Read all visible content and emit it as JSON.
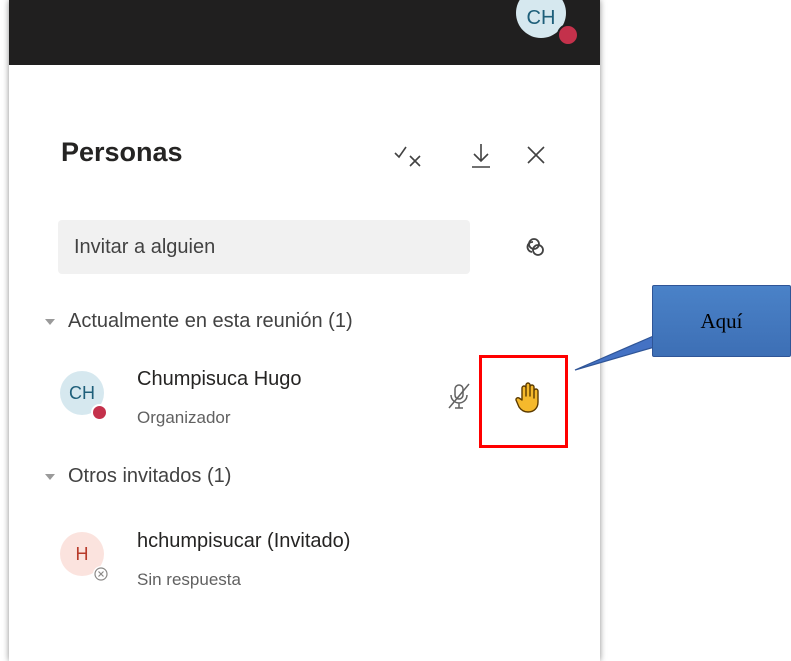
{
  "panel": {
    "title": "Personas",
    "top_avatar_initials": "CH",
    "invite_placeholder": "Invitar a alguien"
  },
  "sections": {
    "current": "Actualmente en esta reunión (1)",
    "others": "Otros invitados (1)"
  },
  "participants": [
    {
      "initials": "CH",
      "name": "Chumpisuca Hugo",
      "role": "Organizador",
      "avatar_bg": "#d6e8ef",
      "avatar_fg": "#1e5f7a",
      "status_color": "#c4314b"
    },
    {
      "initials": "H",
      "name": "hchumpisucar (Invitado)",
      "role": "Sin respuesta",
      "avatar_bg": "#fbe3de",
      "avatar_fg": "#b83b2a"
    }
  ],
  "callout": {
    "text": "Aquí"
  },
  "icons": {
    "header": [
      "check-x-icon",
      "download-icon",
      "close-icon"
    ],
    "invite_link": "link-icon",
    "participant_actions": [
      "mic-off-icon",
      "raised-hand-icon"
    ]
  },
  "colors": {
    "topbar": "#201f1f",
    "hand": "#f5b92c",
    "highlight": "#ff0000",
    "callout_fill": "#4472c4"
  }
}
